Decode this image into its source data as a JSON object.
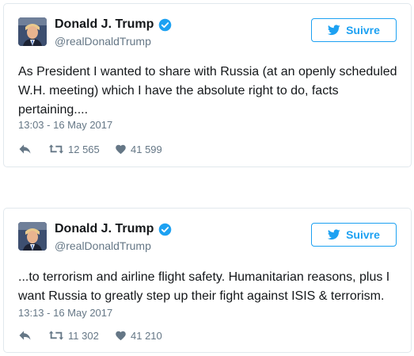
{
  "tweets": [
    {
      "name": "Donald J. Trump",
      "handle": "@realDonaldTrump",
      "follow_label": "Suivre",
      "text": "As President I wanted to share with Russia (at an openly scheduled W.H. meeting) which I have the absolute right to do, facts pertaining....",
      "timestamp": "13:03 - 16 May 2017",
      "retweets": "12 565",
      "likes": "41 599"
    },
    {
      "name": "Donald J. Trump",
      "handle": "@realDonaldTrump",
      "follow_label": "Suivre",
      "text": "...to terrorism and airline flight safety. Humanitarian reasons, plus I want Russia to greatly step up their fight against ISIS & terrorism.",
      "timestamp": "13:13 - 16 May 2017",
      "retweets": "11 302",
      "likes": "41 210"
    }
  ],
  "icons": {
    "verified": "verified-badge-icon",
    "follow": "twitter-bird-icon",
    "reply": "reply-icon",
    "retweet": "retweet-icon",
    "like": "heart-icon"
  },
  "colors": {
    "accent": "#1da1f2",
    "text": "#14171a",
    "muted": "#657786",
    "border": "#e1e8ed"
  }
}
